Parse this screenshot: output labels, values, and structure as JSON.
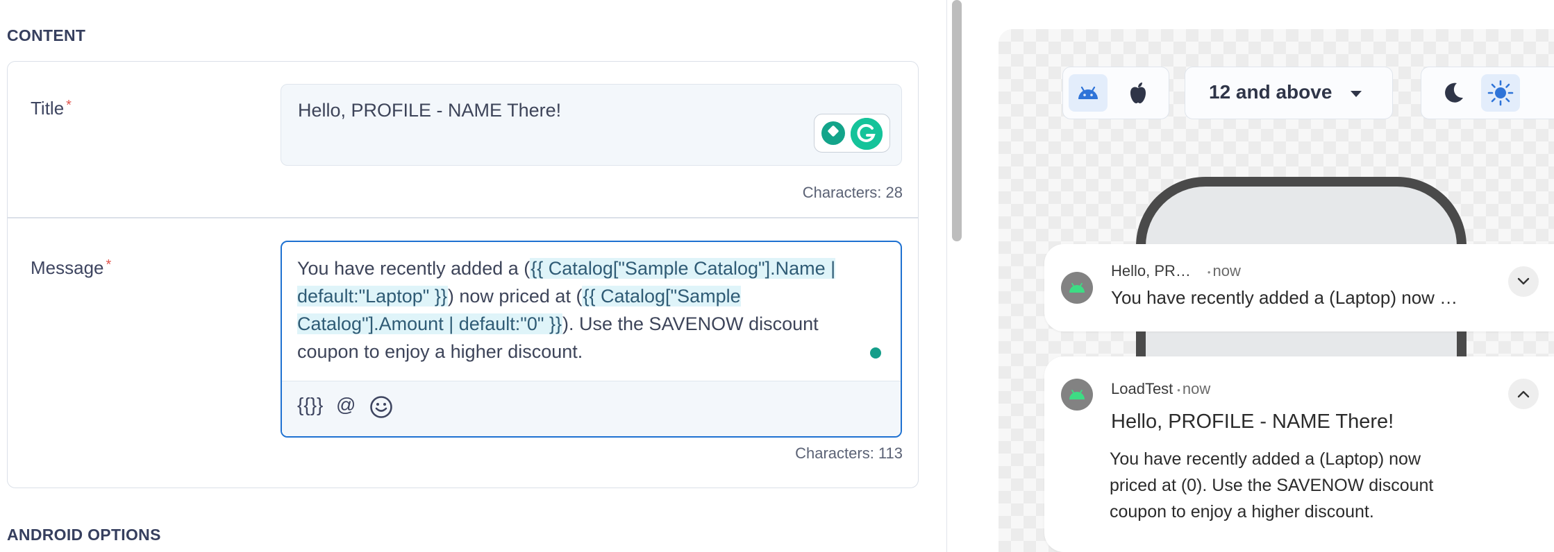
{
  "content": {
    "heading": "CONTENT",
    "title_field": {
      "label": "Title",
      "required_mark": "*",
      "value": "Hello, PROFILE - NAME There!",
      "count_label": "Characters: 28"
    },
    "message_field": {
      "label": "Message",
      "required_mark": "*",
      "seg1": "You have recently added a (",
      "tok1": "{{ Catalog[\"Sample Catalog\"].Name | default:\"Laptop\" }}",
      "seg2": ") now priced at (",
      "tok2": "{{ Catalog[\"Sample Catalog\"].Amount | default:\"0\" }}",
      "seg3": "). Use the SAVENOW discount coupon to enjoy a higher discount.",
      "tool_personalize": "{{}}",
      "tool_mention": "@",
      "count_label": "Characters: 113"
    }
  },
  "android_options": {
    "heading": "ANDROID OPTIONS"
  },
  "preview": {
    "version_select": "12 and above",
    "collapsed": {
      "app": "Hello, PR…",
      "time": "now",
      "body": "You have recently added a (Laptop) now …"
    },
    "expanded": {
      "app": "LoadTest",
      "time": "now",
      "title": "Hello, PROFILE - NAME There!",
      "body_line1": "You have recently added a (Laptop) now",
      "body_line2": "priced at (0). Use the SAVENOW discount",
      "body_line3": "coupon to enjoy a higher discount."
    }
  },
  "colors": {
    "accent": "#1e71d1",
    "required": "#e0554d",
    "grammarly": "#15c39a",
    "android_green": "#3ddc84"
  }
}
